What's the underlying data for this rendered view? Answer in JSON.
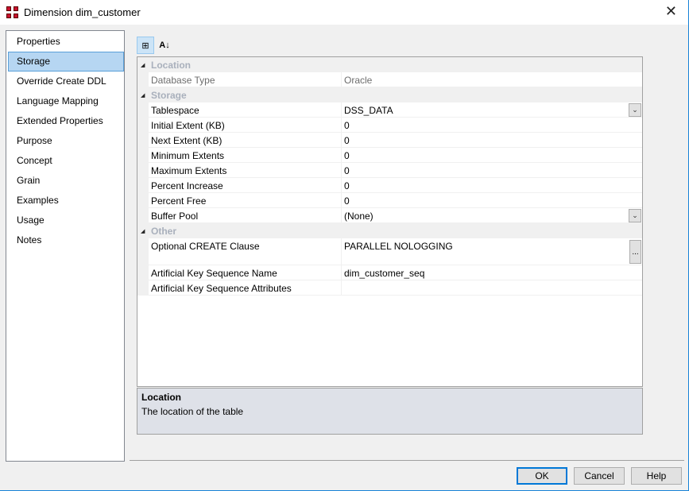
{
  "window": {
    "title": "Dimension dim_customer",
    "close_label": "✕"
  },
  "nav": {
    "items": [
      "Properties",
      "Storage",
      "Override Create DDL",
      "Language Mapping",
      "Extended Properties",
      "Purpose",
      "Concept",
      "Grain",
      "Examples",
      "Usage",
      "Notes"
    ],
    "selected": 1
  },
  "toolbar": {
    "categorized_icon": "⊞",
    "alphabetical_label": "A↓"
  },
  "grid": {
    "rows": [
      {
        "type": "cat",
        "label": "Location"
      },
      {
        "type": "prop",
        "label": "Database Type",
        "value": "Oracle",
        "disabled": true
      },
      {
        "type": "cat",
        "label": "Storage"
      },
      {
        "type": "prop",
        "label": "Tablespace",
        "value": "DSS_DATA",
        "editor": "dropdown"
      },
      {
        "type": "prop",
        "label": "Initial Extent (KB)",
        "value": "0"
      },
      {
        "type": "prop",
        "label": "Next Extent (KB)",
        "value": "0"
      },
      {
        "type": "prop",
        "label": "Minimum Extents",
        "value": "0"
      },
      {
        "type": "prop",
        "label": "Maximum Extents",
        "value": "0"
      },
      {
        "type": "prop",
        "label": "Percent Increase",
        "value": "0"
      },
      {
        "type": "prop",
        "label": "Percent Free",
        "value": "0"
      },
      {
        "type": "prop",
        "label": "Buffer Pool",
        "value": "(None)",
        "editor": "dropdown"
      },
      {
        "type": "cat",
        "label": "Other"
      },
      {
        "type": "prop",
        "label": "Optional CREATE Clause",
        "value": "PARALLEL NOLOGGING",
        "editor": "ellipsis",
        "tall": true
      },
      {
        "type": "prop",
        "label": "Artificial Key Sequence Name",
        "value": "dim_customer_seq"
      },
      {
        "type": "prop",
        "label": "Artificial Key Sequence Attributes",
        "value": ""
      }
    ]
  },
  "description": {
    "title": "Location",
    "text": "The location of the table"
  },
  "buttons": {
    "ok": "OK",
    "cancel": "Cancel",
    "help": "Help"
  }
}
